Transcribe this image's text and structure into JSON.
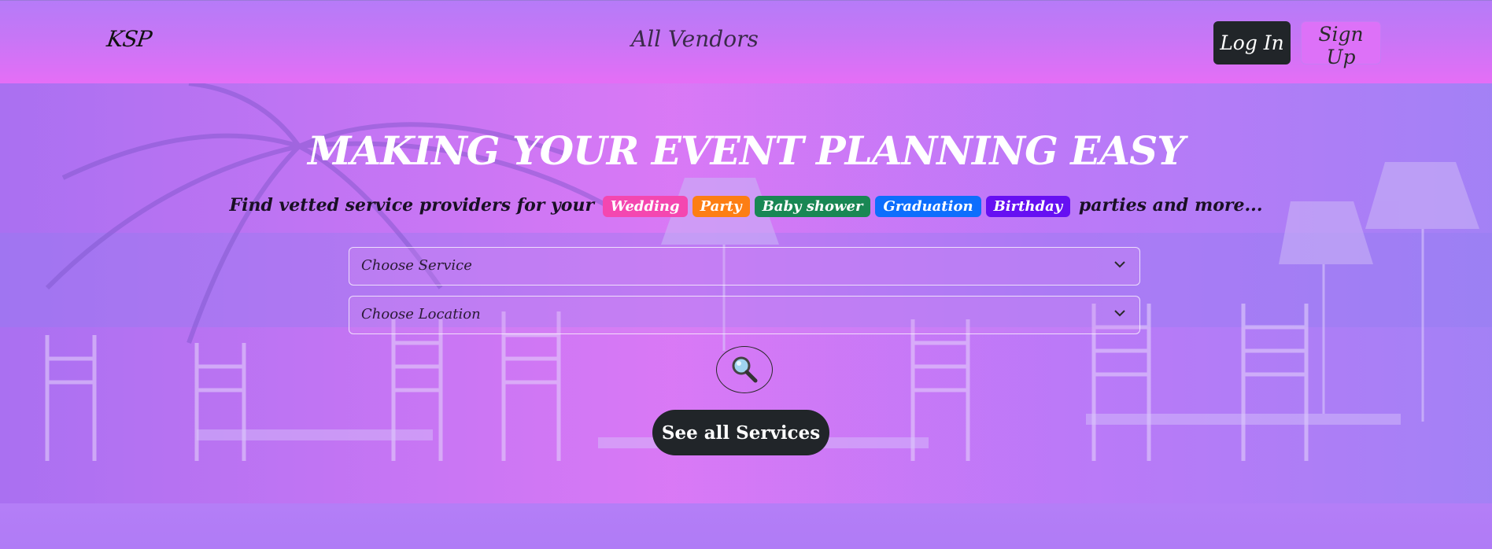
{
  "navbar": {
    "brand": "KSP",
    "center_link": "All Vendors",
    "login_label": "Log In",
    "signup_label": "Sign Up"
  },
  "hero": {
    "headline": "MAKING YOUR EVENT PLANNING EASY",
    "tagline_prefix": "Find vetted service providers for your",
    "tags": [
      {
        "label": "Wedding",
        "color": "#f447b0"
      },
      {
        "label": "Party",
        "color": "#fd7e14"
      },
      {
        "label": "Baby shower",
        "color": "#198754"
      },
      {
        "label": "Graduation",
        "color": "#0d6efd"
      },
      {
        "label": "Birthday",
        "color": "#6610f2"
      }
    ],
    "tagline_suffix": "parties and more...",
    "service_select": {
      "selected": "Choose Service"
    },
    "location_select": {
      "selected": "Choose Location"
    },
    "search_icon": "magnifying-glass-icon",
    "see_all_label": "See all Services"
  }
}
